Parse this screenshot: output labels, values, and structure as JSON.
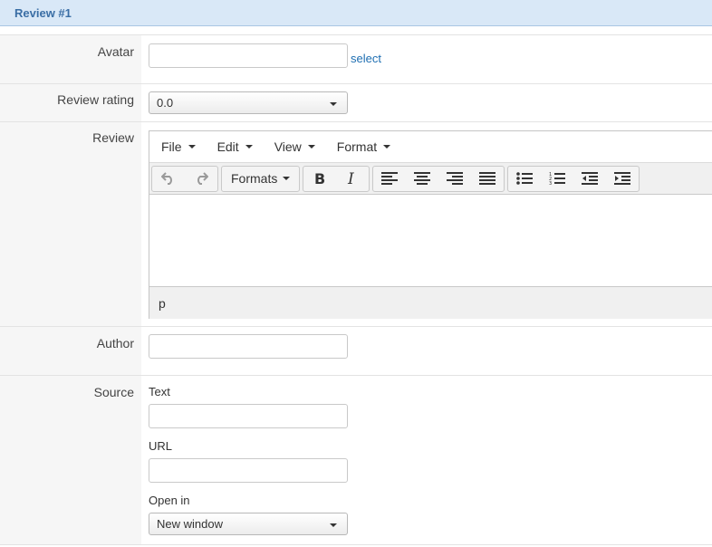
{
  "panel": {
    "title": "Review #1"
  },
  "fields": {
    "avatar": {
      "label": "Avatar",
      "value": "",
      "select_link": "select"
    },
    "rating": {
      "label": "Review rating",
      "value": "0.0"
    },
    "review": {
      "label": "Review",
      "menus": [
        "File",
        "Edit",
        "View",
        "Format"
      ],
      "formats_label": "Formats",
      "content": "",
      "status_path": "p"
    },
    "author": {
      "label": "Author",
      "value": ""
    },
    "source": {
      "label": "Source",
      "text_label": "Text",
      "text_value": "",
      "url_label": "URL",
      "url_value": "",
      "open_in_label": "Open in",
      "open_in_value": "New window"
    }
  },
  "icons": [
    "undo-icon",
    "redo-icon",
    "bold-icon",
    "italic-icon",
    "align-left-icon",
    "align-center-icon",
    "align-right-icon",
    "align-justify-icon",
    "bullet-list-icon",
    "numbered-list-icon",
    "outdent-icon",
    "indent-icon"
  ]
}
